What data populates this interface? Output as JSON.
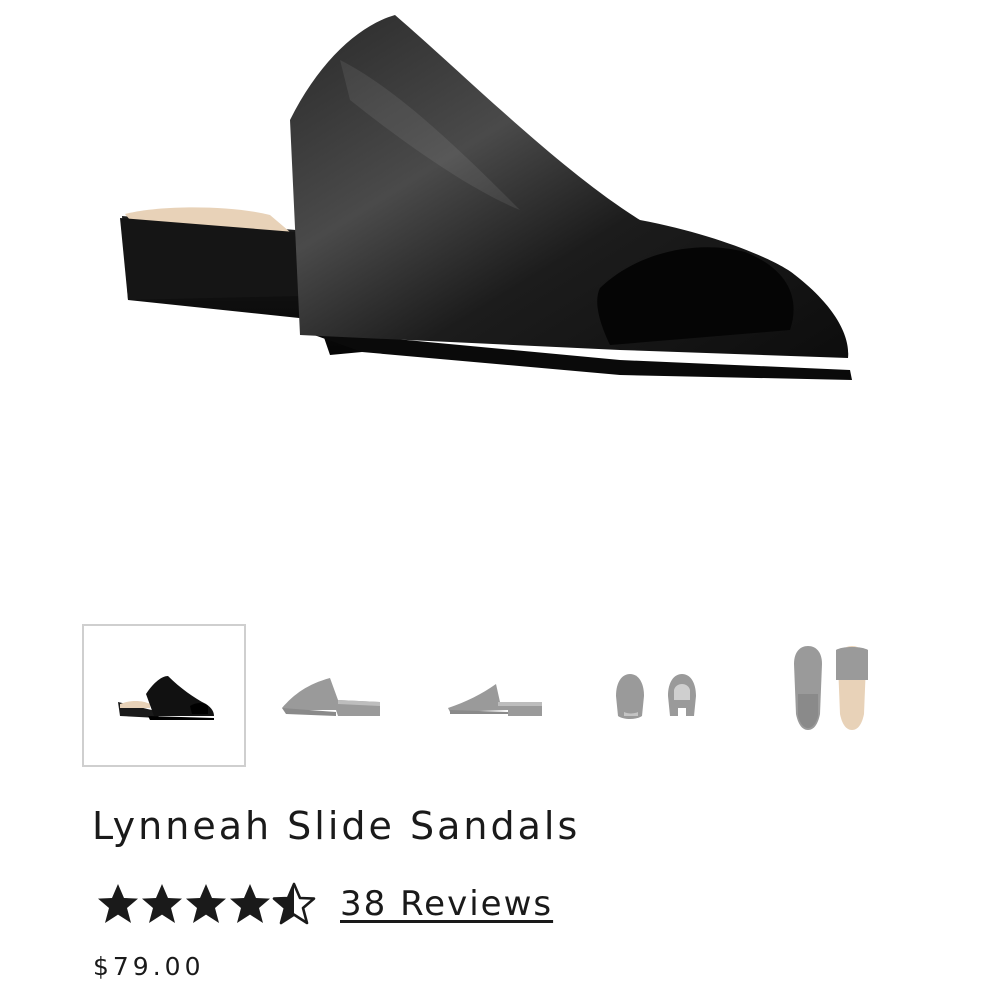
{
  "product": {
    "title": "Lynneah Slide Sandals",
    "rating": 4.5,
    "rating_max": 5,
    "reviews_label": "38 Reviews",
    "price": "$79.00"
  },
  "gallery": {
    "main_image": "black-leather-slide-sandal-side-view",
    "thumbnails": [
      {
        "name": "side-view",
        "selected": true
      },
      {
        "name": "outer-side-view",
        "selected": false
      },
      {
        "name": "inner-side-view",
        "selected": false
      },
      {
        "name": "front-and-back-view",
        "selected": false
      },
      {
        "name": "top-view-pair",
        "selected": false
      }
    ]
  },
  "colors": {
    "text": "#1a1a1a",
    "star": "#1a1a1a",
    "thumb_border": "#cfcfcf",
    "thumb_inactive": "#9a9a9a",
    "shoe": "#111111",
    "insole": "#e8d2b8"
  },
  "icons": {
    "star_full": "star-filled-icon",
    "star_half": "star-half-icon"
  }
}
